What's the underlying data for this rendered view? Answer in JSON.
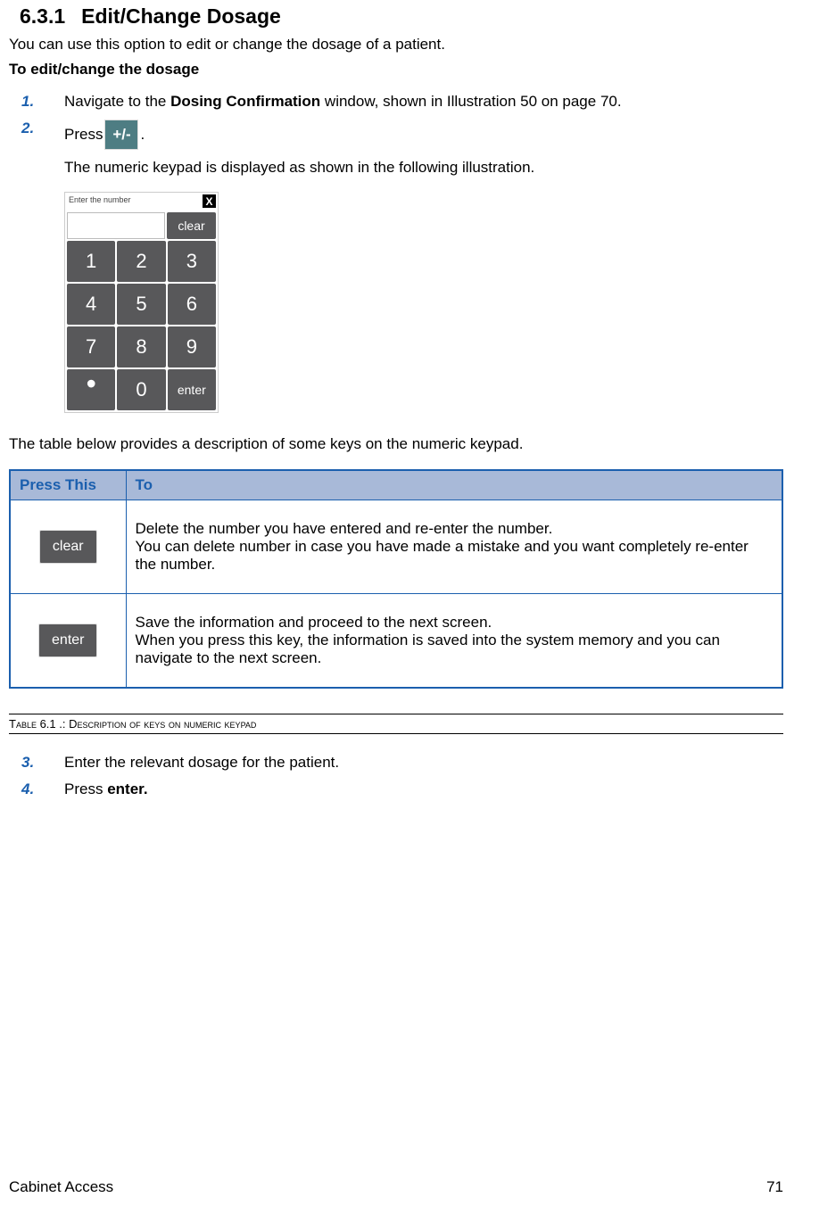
{
  "heading": {
    "number": "6.3.1",
    "title": "Edit/Change Dosage"
  },
  "intro": "You can use this option to edit or change the dosage of a patient.",
  "subhead": "To edit/change the dosage",
  "steps": {
    "s1": {
      "marker": "1.",
      "pre": "Navigate to the ",
      "bold": "Dosing Confirmation",
      "post": " window, shown in Illustration 50 on page 70."
    },
    "s2": {
      "marker": "2.",
      "pre": "Press ",
      "btn": "+/-",
      "post": ".",
      "after": "The numeric keypad is displayed as shown in the following illustration."
    },
    "s3": {
      "marker": "3.",
      "text": "Enter the relevant dosage for the patient."
    },
    "s4": {
      "marker": "4.",
      "pre": "Press ",
      "bold": "enter.",
      "post": ""
    }
  },
  "keypad": {
    "title": "Enter the number",
    "close": "X",
    "clear": "clear",
    "k1": "1",
    "k2": "2",
    "k3": "3",
    "k4": "4",
    "k5": "5",
    "k6": "6",
    "k7": "7",
    "k8": "8",
    "k9": "9",
    "dot": "•",
    "k0": "0",
    "enter": "enter"
  },
  "table_intro": "The table below provides a description of some keys on the numeric keypad.",
  "table": {
    "headers": {
      "col1": "Press This",
      "col2": "To"
    },
    "rows": [
      {
        "key_label": "clear",
        "line1": "Delete the number  you have entered and re-enter the number.",
        "line2": "You can delete number in case you have made a mistake and you want completely re-enter the number."
      },
      {
        "key_label": "enter",
        "line1": "Save the information and proceed to the next screen.",
        "line2": "When you press this key, the information is saved into the system memory and you can navigate to the next screen."
      }
    ]
  },
  "caption": {
    "prefix": "Table 6.1 .: ",
    "text": "Description of keys on numeric keypad"
  },
  "footer": {
    "left": "Cabinet Access",
    "right": "71"
  }
}
